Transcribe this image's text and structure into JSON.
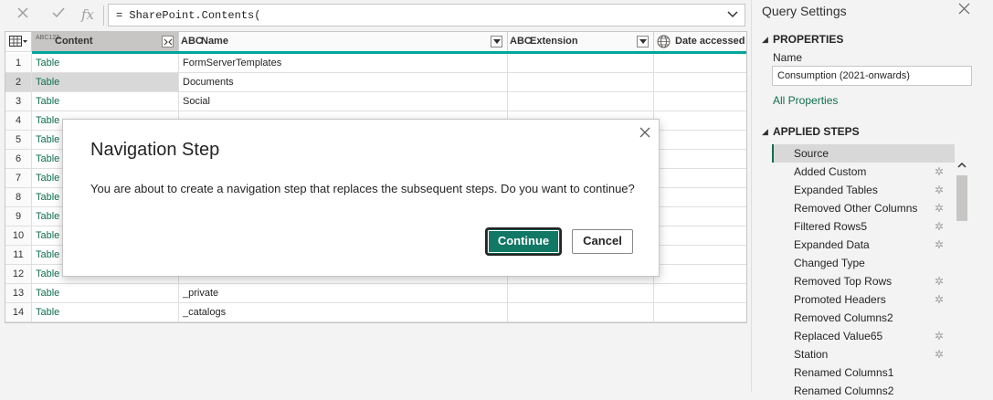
{
  "formula": {
    "cancel_icon": "cancel-icon",
    "confirm_icon": "check-icon",
    "fx_label": "fx",
    "text": "= SharePoint.Contents("
  },
  "grid": {
    "columns": [
      {
        "type_icon": "ABC123",
        "label": "Content"
      },
      {
        "type_icon": "ABC",
        "label": "Name"
      },
      {
        "type_icon": "ABC",
        "label": "Extension"
      },
      {
        "type_icon": "globe-icon",
        "label": "Date accessed"
      }
    ],
    "rows": [
      {
        "n": "1",
        "content": "Table",
        "name": "FormServerTemplates"
      },
      {
        "n": "2",
        "content": "Table",
        "name": "Documents"
      },
      {
        "n": "3",
        "content": "Table",
        "name": "Social"
      },
      {
        "n": "4",
        "content": "Table",
        "name": ""
      },
      {
        "n": "5",
        "content": "Table",
        "name": ""
      },
      {
        "n": "6",
        "content": "Table",
        "name": ""
      },
      {
        "n": "7",
        "content": "Table",
        "name": ""
      },
      {
        "n": "8",
        "content": "Table",
        "name": ""
      },
      {
        "n": "9",
        "content": "Table",
        "name": ""
      },
      {
        "n": "10",
        "content": "Table",
        "name": ""
      },
      {
        "n": "11",
        "content": "Table",
        "name": ""
      },
      {
        "n": "12",
        "content": "Table",
        "name": ""
      },
      {
        "n": "13",
        "content": "Table",
        "name": "_private"
      },
      {
        "n": "14",
        "content": "Table",
        "name": "_catalogs"
      }
    ]
  },
  "query_settings": {
    "title": "Query Settings",
    "properties_header": "PROPERTIES",
    "name_label": "Name",
    "name_value": "Consumption (2021-onwards)",
    "all_properties_link": "All Properties",
    "applied_steps_header": "APPLIED STEPS",
    "steps": [
      {
        "label": "Source",
        "gear": false
      },
      {
        "label": "Added Custom",
        "gear": true
      },
      {
        "label": "Expanded Tables",
        "gear": true
      },
      {
        "label": "Removed Other Columns",
        "gear": true
      },
      {
        "label": "Filtered Rows5",
        "gear": true
      },
      {
        "label": "Expanded Data",
        "gear": true
      },
      {
        "label": "Changed Type",
        "gear": false
      },
      {
        "label": "Removed Top Rows",
        "gear": true
      },
      {
        "label": "Promoted Headers",
        "gear": true
      },
      {
        "label": "Removed Columns2",
        "gear": false
      },
      {
        "label": "Replaced Value65",
        "gear": true
      },
      {
        "label": "Station",
        "gear": true
      },
      {
        "label": "Renamed Columns1",
        "gear": false
      },
      {
        "label": "Renamed Columns2",
        "gear": false
      }
    ]
  },
  "dialog": {
    "title": "Navigation Step",
    "message": "You are about to create a navigation step that replaces the subsequent steps. Do you want to continue?",
    "continue_label": "Continue",
    "cancel_label": "Cancel"
  },
  "colors": {
    "accent": "#117865",
    "teal_bar": "#00a59b",
    "link": "#0f6e50"
  }
}
